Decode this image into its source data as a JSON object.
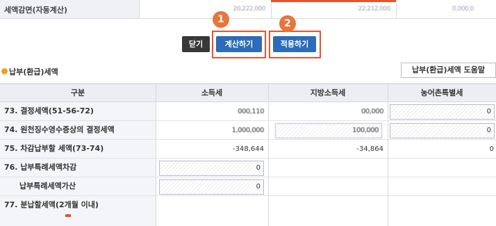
{
  "top_row": {
    "label": "세액감면(자동계산)",
    "values": [
      "20,222,000",
      "22,212,000",
      "0,000,0"
    ]
  },
  "buttons": {
    "close": "닫기",
    "calculate": "계산하기",
    "apply": "적용하기"
  },
  "badges": {
    "first": "1",
    "second": "2"
  },
  "section": {
    "title": "납부(환급)세액",
    "help_button": "납부(환급)세액 도움말"
  },
  "table": {
    "headers": [
      "구분",
      "소득세",
      "지방소득세",
      "농어촌특별세"
    ],
    "rows": [
      {
        "label": "73. 결정세액(51-56-72)",
        "income_tax": "000,110",
        "local_tax": "00,000",
        "rural_tax": "0"
      },
      {
        "label": "74. 원천징수영수증상의 결정세액",
        "income_tax": "1,000,000",
        "local_tax": "100,000",
        "rural_tax": "0"
      },
      {
        "label": "75. 차감납부할 세액(73-74)",
        "income_tax": "-348,644",
        "local_tax": "-34,864",
        "rural_tax": "0"
      },
      {
        "label": "76. 납부특례세액차감",
        "income_tax": "0"
      },
      {
        "label": "납부특례세액가산",
        "income_tax": "0"
      },
      {
        "label": "77. 분납할세액(2개월 이내)"
      }
    ]
  },
  "colors": {
    "accent_blue": "#2c6cb8",
    "highlight_red": "#e4542f",
    "badge_orange": "#e8753a"
  }
}
